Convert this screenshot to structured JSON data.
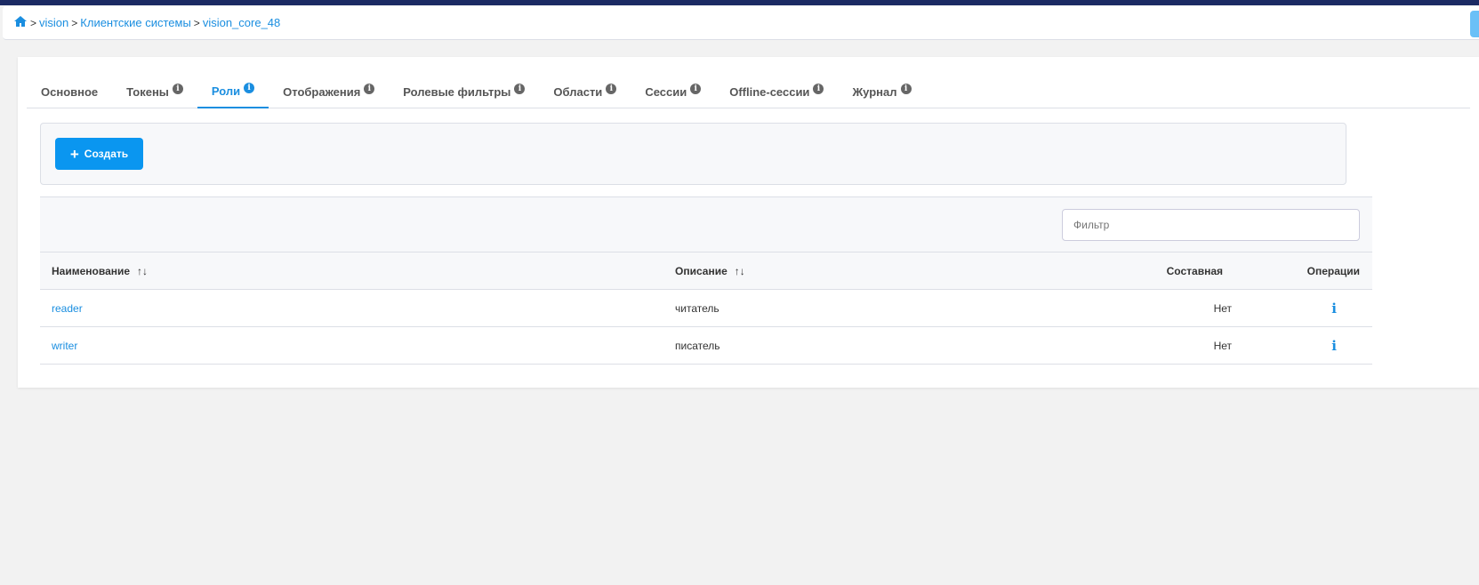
{
  "breadcrumb": {
    "items": [
      "vision",
      "Клиентские системы",
      "vision_core_48"
    ]
  },
  "tabs": [
    {
      "label": "Основное",
      "info": false
    },
    {
      "label": "Токены",
      "info": true
    },
    {
      "label": "Роли",
      "info": true,
      "active": true
    },
    {
      "label": "Отображения",
      "info": true
    },
    {
      "label": "Ролевые фильтры",
      "info": true
    },
    {
      "label": "Области",
      "info": true
    },
    {
      "label": "Сессии",
      "info": true
    },
    {
      "label": "Offline-сессии",
      "info": true
    },
    {
      "label": "Журнал",
      "info": true
    }
  ],
  "toolbar": {
    "create_label": "Создать"
  },
  "filter": {
    "placeholder": "Фильтр",
    "value": ""
  },
  "table": {
    "headers": {
      "name": "Наименование",
      "description": "Описание",
      "composite": "Составная",
      "operations": "Операции"
    },
    "rows": [
      {
        "name": "reader",
        "description": "читатель",
        "composite": "Нет",
        "op": "i"
      },
      {
        "name": "writer",
        "description": "писатель",
        "composite": "Нет",
        "op": "i"
      }
    ]
  },
  "colors": {
    "accent": "#1a8ee0",
    "button": "#0a96f0",
    "topbar": "#1b2a63"
  }
}
